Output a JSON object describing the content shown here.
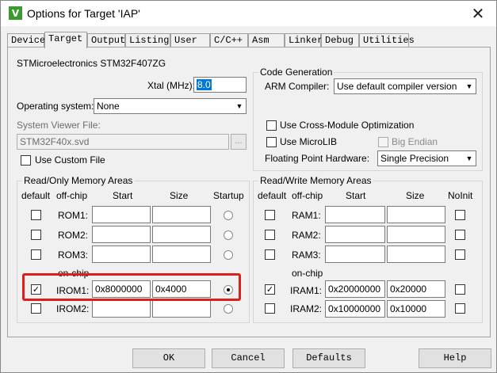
{
  "window": {
    "title": "Options for Target 'IAP'",
    "icon_letter": "V",
    "close_symbol": "✕"
  },
  "tabs": [
    {
      "label": "Device"
    },
    {
      "label": "Target"
    },
    {
      "label": "Output"
    },
    {
      "label": "Listing"
    },
    {
      "label": "User"
    },
    {
      "label": "C/C++"
    },
    {
      "label": "Asm"
    },
    {
      "label": "Linker"
    },
    {
      "label": "Debug"
    },
    {
      "label": "Utilities"
    }
  ],
  "device_name": "STMicroelectronics STM32F407ZG",
  "xtal": {
    "label": "Xtal (MHz):",
    "value": "8.0"
  },
  "os": {
    "label": "Operating system:",
    "value": "None"
  },
  "svf": {
    "label": "System Viewer File:",
    "value": "STM32F40x.svd",
    "browse": "..."
  },
  "custom_file": {
    "label": "Use Custom File",
    "checked": false
  },
  "codegen": {
    "title": "Code Generation",
    "compiler_label": "ARM Compiler:",
    "compiler_value": "Use default compiler version",
    "cross_module": "Use Cross-Module Optimization",
    "microlib": "Use MicroLIB",
    "big_endian": "Big Endian",
    "fp_label": "Floating Point Hardware:",
    "fp_value": "Single Precision"
  },
  "rom": {
    "title": "Read/Only Memory Areas",
    "headers": {
      "default": "default",
      "offchip": "off-chip",
      "start": "Start",
      "size": "Size",
      "startup": "Startup"
    },
    "onchip_label": "on-chip",
    "rows": [
      {
        "name": "ROM1:",
        "start": "",
        "size": "",
        "default": false,
        "startup": false
      },
      {
        "name": "ROM2:",
        "start": "",
        "size": "",
        "default": false,
        "startup": false
      },
      {
        "name": "ROM3:",
        "start": "",
        "size": "",
        "default": false,
        "startup": false
      },
      {
        "name": "IROM1:",
        "start": "0x8000000",
        "size": "0x4000",
        "default": true,
        "startup": true
      },
      {
        "name": "IROM2:",
        "start": "",
        "size": "",
        "default": false,
        "startup": false
      }
    ]
  },
  "ram": {
    "title": "Read/Write Memory Areas",
    "headers": {
      "default": "default",
      "offchip": "off-chip",
      "start": "Start",
      "size": "Size",
      "noinit": "NoInit"
    },
    "onchip_label": "on-chip",
    "rows": [
      {
        "name": "RAM1:",
        "start": "",
        "size": "",
        "default": false,
        "noinit": false
      },
      {
        "name": "RAM2:",
        "start": "",
        "size": "",
        "default": false,
        "noinit": false
      },
      {
        "name": "RAM3:",
        "start": "",
        "size": "",
        "default": false,
        "noinit": false
      },
      {
        "name": "IRAM1:",
        "start": "0x20000000",
        "size": "0x20000",
        "default": true,
        "noinit": false
      },
      {
        "name": "IRAM2:",
        "start": "0x10000000",
        "size": "0x10000",
        "default": false,
        "noinit": false
      }
    ]
  },
  "buttons": {
    "ok": "OK",
    "cancel": "Cancel",
    "defaults": "Defaults",
    "help": "Help"
  },
  "colors": {
    "highlight": "#d9201c",
    "selection": "#0078d7"
  }
}
